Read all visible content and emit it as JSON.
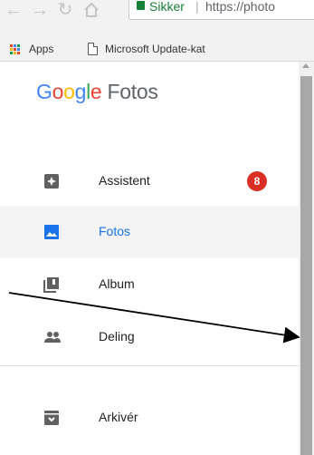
{
  "browser": {
    "nav_icons": [
      "back-arrow-icon",
      "forward-arrow-icon",
      "reload-icon",
      "home-icon"
    ],
    "secure_label": "Sikker",
    "separator": "|",
    "url": "https://photo",
    "bookmarks": [
      {
        "label": "Apps",
        "icon": "apps-grid-icon"
      },
      {
        "label": "Microsoft Update-kat",
        "icon": "document-icon"
      }
    ]
  },
  "app": {
    "logo_google": "Google",
    "logo_fotos": "Fotos",
    "nav": [
      {
        "label": "Assistent",
        "icon": "assistant-icon",
        "badge": "8"
      },
      {
        "label": "Fotos",
        "icon": "photo-icon",
        "active": true
      },
      {
        "label": "Album",
        "icon": "album-icon"
      },
      {
        "label": "Deling",
        "icon": "people-icon"
      }
    ],
    "nav_secondary": [
      {
        "label": "Arkivér",
        "icon": "archive-icon"
      }
    ]
  },
  "colors": {
    "accent": "#1a73e8",
    "badge": "#d93025",
    "secure": "#188038",
    "icon": "#616161"
  }
}
